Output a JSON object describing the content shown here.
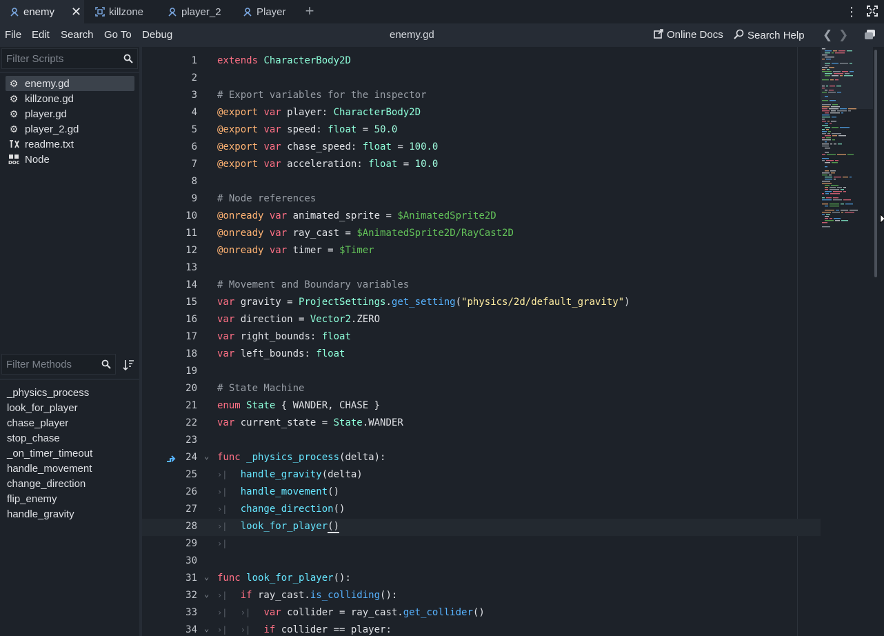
{
  "tabs": [
    {
      "label": "enemy",
      "icon": "script-node-icon",
      "active": true
    },
    {
      "label": "killzone",
      "icon": "area-node-icon"
    },
    {
      "label": "player_2",
      "icon": "script-node-icon"
    },
    {
      "label": "Player",
      "icon": "script-node-icon"
    }
  ],
  "menu": {
    "items": [
      "File",
      "Edit",
      "Search",
      "Go To",
      "Debug"
    ],
    "file_title": "enemy.gd",
    "online_docs": "Online Docs",
    "search_help": "Search Help"
  },
  "scripts": {
    "filter_placeholder": "Filter Scripts",
    "items": [
      {
        "label": "enemy.gd",
        "icon": "gear-icon",
        "selected": true
      },
      {
        "label": "killzone.gd",
        "icon": "gear-icon"
      },
      {
        "label": "player.gd",
        "icon": "gear-icon"
      },
      {
        "label": "player_2.gd",
        "icon": "gear-icon"
      },
      {
        "label": "readme.txt",
        "icon": "text-file-icon"
      },
      {
        "label": "Node",
        "icon": "doc-icon"
      }
    ]
  },
  "methods": {
    "filter_placeholder": "Filter Methods",
    "items": [
      "_physics_process",
      "look_for_player",
      "chase_player",
      "stop_chase",
      "_on_timer_timeout",
      "handle_movement",
      "change_direction",
      "flip_enemy",
      "handle_gravity"
    ]
  },
  "editor": {
    "current_line": 28,
    "lines": [
      {
        "n": "1",
        "text": "extends CharacterBody2D"
      },
      {
        "n": "2",
        "text": ""
      },
      {
        "n": "3",
        "text": "# Export variables for the inspector"
      },
      {
        "n": "4",
        "text": "@export var player: CharacterBody2D"
      },
      {
        "n": "5",
        "text": "@export var speed: float = 50.0"
      },
      {
        "n": "6",
        "text": "@export var chase_speed: float = 100.0"
      },
      {
        "n": "7",
        "text": "@export var acceleration: float = 10.0"
      },
      {
        "n": "8",
        "text": ""
      },
      {
        "n": "9",
        "text": "# Node references"
      },
      {
        "n": "10",
        "text": "@onready var animated_sprite = $AnimatedSprite2D"
      },
      {
        "n": "11",
        "text": "@onready var ray_cast = $AnimatedSprite2D/RayCast2D"
      },
      {
        "n": "12",
        "text": "@onready var timer = $Timer"
      },
      {
        "n": "13",
        "text": ""
      },
      {
        "n": "14",
        "text": "# Movement and Boundary variables"
      },
      {
        "n": "15",
        "text": "var gravity = ProjectSettings.get_setting(\"physics/2d/default_gravity\")"
      },
      {
        "n": "16",
        "text": "var direction = Vector2.ZERO"
      },
      {
        "n": "17",
        "text": "var right_bounds: float"
      },
      {
        "n": "18",
        "text": "var left_bounds: float"
      },
      {
        "n": "19",
        "text": ""
      },
      {
        "n": "20",
        "text": "# State Machine"
      },
      {
        "n": "21",
        "text": "enum State { WANDER, CHASE }"
      },
      {
        "n": "22",
        "text": "var current_state = State.WANDER"
      },
      {
        "n": "23",
        "text": ""
      },
      {
        "n": "24",
        "text": "func _physics_process(delta):"
      },
      {
        "n": "25",
        "text": "handle_gravity(delta)"
      },
      {
        "n": "26",
        "text": "handle_movement()"
      },
      {
        "n": "27",
        "text": "change_direction()"
      },
      {
        "n": "28",
        "text": "look_for_player()"
      },
      {
        "n": "29",
        "text": ""
      },
      {
        "n": "30",
        "text": ""
      },
      {
        "n": "31",
        "text": "func look_for_player():"
      },
      {
        "n": "32",
        "text": "if ray_cast.is_colliding():"
      },
      {
        "n": "33",
        "text": "var collider = ray_cast.get_collider()"
      },
      {
        "n": "34",
        "text": "if collider == player:"
      }
    ]
  },
  "colors": {
    "keyword": "#ff7085",
    "annotation": "#ffb373",
    "type": "#8effda",
    "function": "#57b3ff",
    "comment": "#a6acb4",
    "string": "#ffeda1",
    "node_path": "#63c259"
  }
}
